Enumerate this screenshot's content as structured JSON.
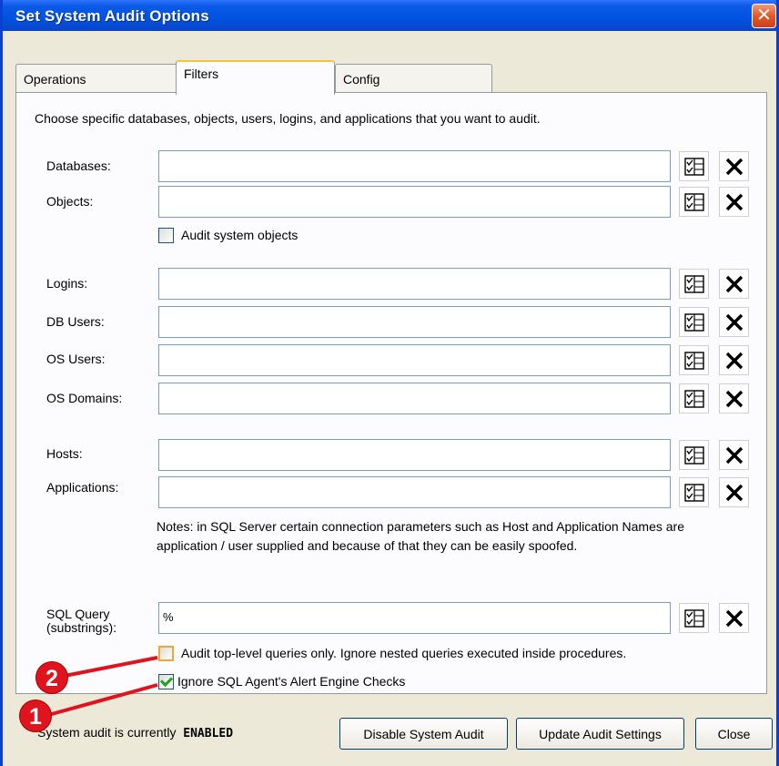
{
  "window": {
    "title": "Set System Audit Options",
    "close_glyph": "✕"
  },
  "tabs": [
    {
      "label": "Operations"
    },
    {
      "label": "Filters"
    },
    {
      "label": "Config"
    }
  ],
  "filters": {
    "intro": "Choose specific databases, objects, users, logins, and applications that you want to audit.",
    "databases_label": "Databases:",
    "objects_label": "Objects:",
    "audit_system_objects_label": "Audit system objects",
    "logins_label": "Logins:",
    "db_users_label": "DB Users:",
    "os_users_label": "OS Users:",
    "os_domains_label": "OS Domains:",
    "hosts_label": "Hosts:",
    "applications_label": "Applications:",
    "notes": "Notes:  in SQL Server certain connection parameters such as Host and Application Names are application / user supplied and because of that they can be easily spoofed.",
    "sql_query_label_1": "SQL Query",
    "sql_query_label_2": "(substrings):",
    "sql_query_value": "%",
    "top_level_label": "Audit top-level queries only. Ignore nested queries executed inside procedures.",
    "ignore_agent_label": "Ignore SQL Agent's Alert Engine Checks",
    "ignore_agent_checked": true
  },
  "footer": {
    "status_prefix": "System audit is currently",
    "status_value": "ENABLED",
    "disable_label": "Disable System Audit",
    "update_label": "Update Audit Settings",
    "close_label": "Close"
  },
  "callouts": {
    "one": "1",
    "two": "2"
  },
  "colors": {
    "title_bar": "#0052e0",
    "callout": "#e0141e",
    "check": "#21a121"
  }
}
